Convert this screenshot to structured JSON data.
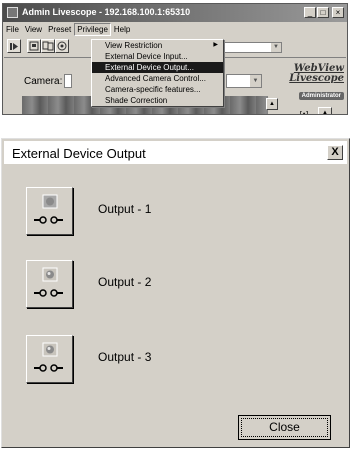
{
  "top_window": {
    "title": "Admin Livescope - 192.168.100.1:65310",
    "menu": [
      "File",
      "View",
      "Preset",
      "Privilege",
      "Help"
    ],
    "active_menu": "Privilege",
    "camera_label": "Camera:",
    "logo_line1": "WebView",
    "logo_line2": "Livescope",
    "logo_badge": "Administrator"
  },
  "dropdown": {
    "items": [
      {
        "label": "View Restriction",
        "has_submenu": true
      },
      {
        "label": "External Device Input..."
      },
      {
        "label": "External Device Output...",
        "highlighted": true
      },
      {
        "label": "Advanced Camera Control..."
      },
      {
        "label": "Camera-specific features..."
      },
      {
        "label": "Shade Correction"
      }
    ]
  },
  "dialog": {
    "title": "External Device Output",
    "close_glyph": "X",
    "outputs": [
      {
        "label": "Output - 1",
        "active": true
      },
      {
        "label": "Output - 2",
        "active": false
      },
      {
        "label": "Output - 3",
        "active": false
      }
    ],
    "close_button": "Close"
  },
  "icons": {
    "window_controls": [
      "_",
      "□",
      "×"
    ],
    "submenu_arrow": "▶"
  }
}
